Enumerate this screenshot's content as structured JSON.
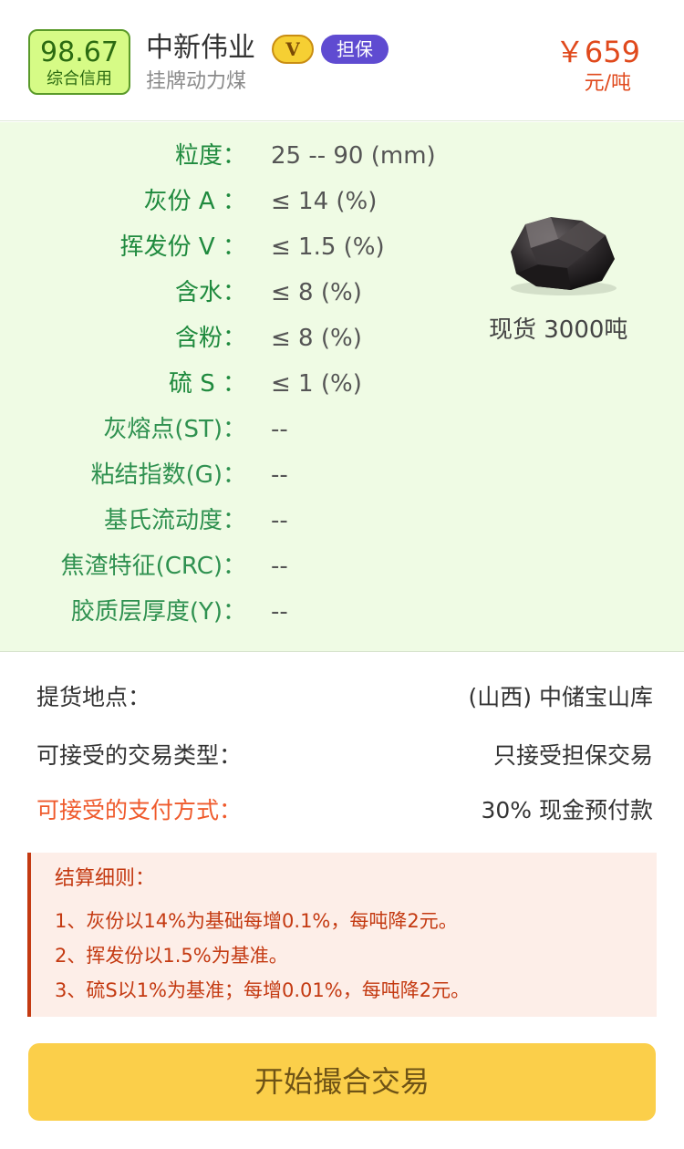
{
  "header": {
    "score": "98.67",
    "score_label": "综合信用",
    "company": "中新伟业",
    "v_badge": "V",
    "guarantee_badge": "担保",
    "subtitle": "挂牌动力煤",
    "price": "￥659",
    "price_unit": "元/吨"
  },
  "specs": [
    {
      "label": "粒度：",
      "value": "25 -- 90 (mm)"
    },
    {
      "label": "灰份 A ：",
      "value": "≤ 14 (%)"
    },
    {
      "label": "挥发份 V ：",
      "value": "≤ 1.5 (%)"
    },
    {
      "label": "含水：",
      "value": "≤ 8 (%)"
    },
    {
      "label": "含粉：",
      "value": "≤ 8 (%)"
    },
    {
      "label": "硫 S ：",
      "value": "≤ 1 (%)"
    },
    {
      "label": "灰熔点(ST)：",
      "value": "--"
    },
    {
      "label": "粘结指数(G)：",
      "value": "--"
    },
    {
      "label": "基氏流动度：",
      "value": "--"
    },
    {
      "label": "焦渣特征(CRC)：",
      "value": "--"
    },
    {
      "label": "胶质层厚度(Y)：",
      "value": "--"
    }
  ],
  "stock": "现货 3000吨",
  "info": [
    {
      "label": "提货地点：",
      "value": "(山西) 中储宝山库"
    },
    {
      "label": "可接受的交易类型：",
      "value": "只接受担保交易"
    },
    {
      "label": "可接受的支付方式：",
      "value": "30% 现金预付款"
    }
  ],
  "notes": {
    "title": "结算细则：",
    "lines": [
      "1、灰份以14%为基础每增0.1%，每吨降2元。",
      "2、挥发份以1.5%为基准。",
      "3、硫S以1%为基准；每增0.01%，每吨降2元。"
    ]
  },
  "action_button": "开始撮合交易",
  "colors": {
    "accent_green": "#1f8a3e",
    "price_red": "#e0491c",
    "button_yellow": "#fbcf4a",
    "notes_red": "#c43a12"
  }
}
